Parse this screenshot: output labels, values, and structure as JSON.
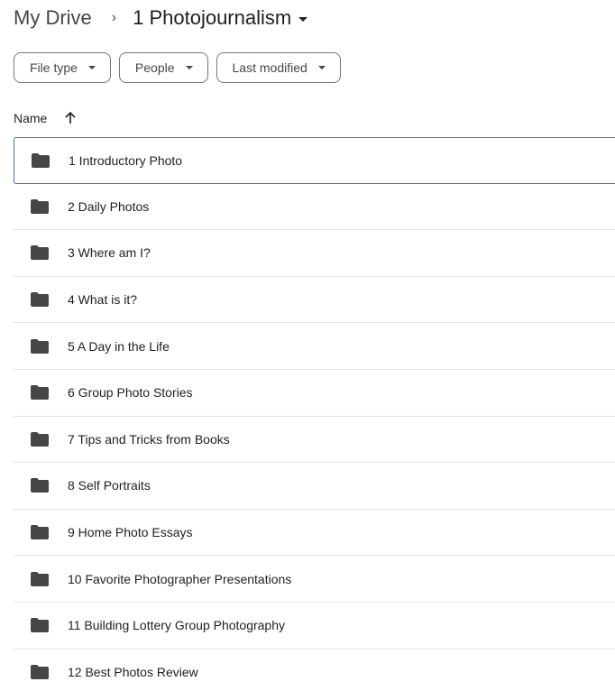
{
  "breadcrumb": {
    "root": "My Drive",
    "separator": "›",
    "current": "1 Photojournalism"
  },
  "filters": [
    {
      "label": "File type"
    },
    {
      "label": "People"
    },
    {
      "label": "Last modified"
    }
  ],
  "columns": {
    "name": "Name",
    "sort": "ascending"
  },
  "icons": {
    "folder": "folder-icon",
    "sort": "arrow-up-icon",
    "dropdown": "caret-down-icon"
  },
  "colors": {
    "folder": "#444746",
    "selected_border": "#4a6fa5",
    "divider": "#e1e3e1"
  },
  "items": [
    {
      "name": "1 Introductory Photo",
      "selected": true
    },
    {
      "name": "2 Daily Photos"
    },
    {
      "name": "3 Where am I?"
    },
    {
      "name": "4 What is it?"
    },
    {
      "name": "5 A Day in the Life"
    },
    {
      "name": "6 Group Photo Stories"
    },
    {
      "name": "7 Tips and Tricks from Books"
    },
    {
      "name": "8 Self Portraits"
    },
    {
      "name": "9 Home Photo Essays"
    },
    {
      "name": "10 Favorite Photographer Presentations"
    },
    {
      "name": "11 Building Lottery Group Photography"
    },
    {
      "name": "12 Best Photos Review"
    }
  ]
}
